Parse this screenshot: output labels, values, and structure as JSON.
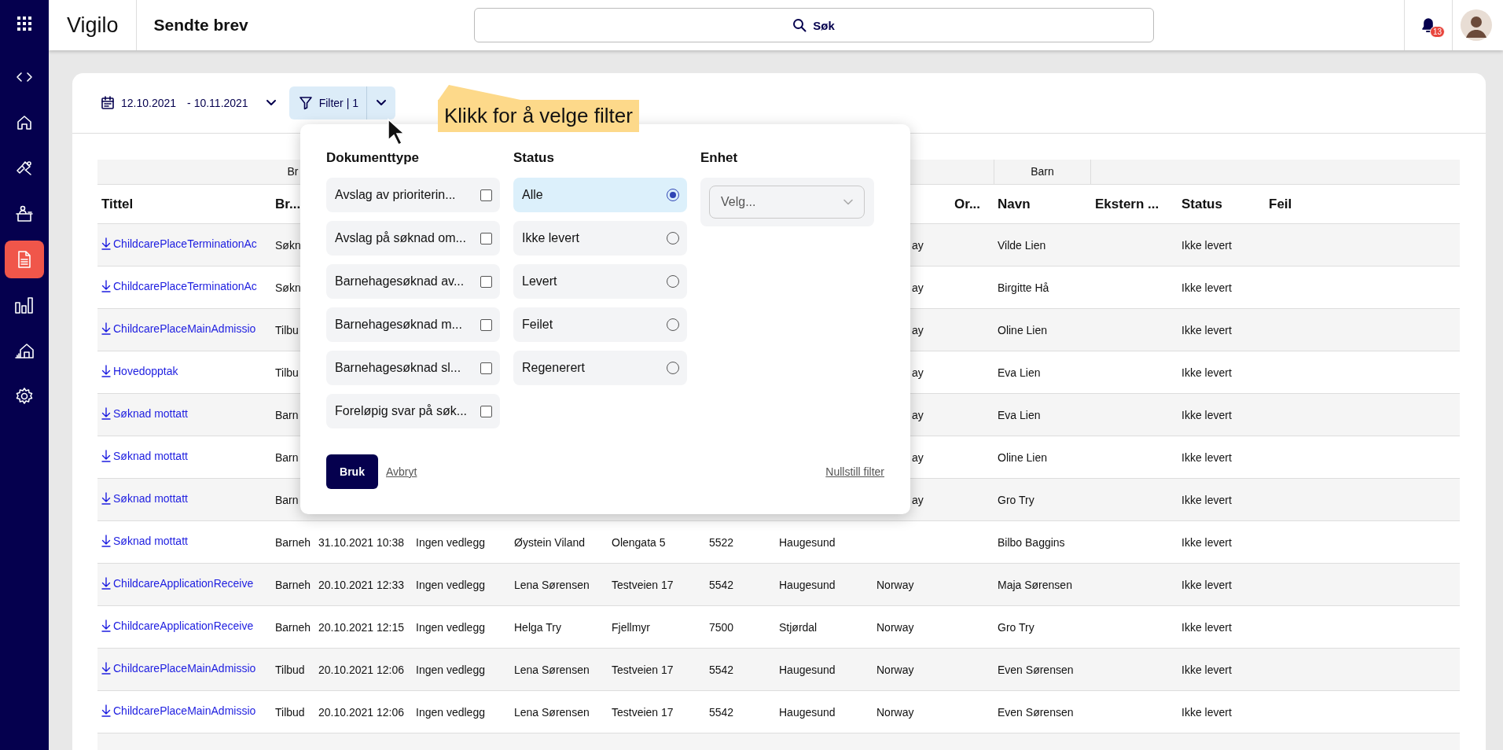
{
  "sidebar": {
    "items": [
      {
        "kind": "apps",
        "selected": false
      },
      {
        "kind": "code",
        "selected": false
      },
      {
        "kind": "home",
        "selected": false
      },
      {
        "kind": "tools",
        "selected": false
      },
      {
        "kind": "desk",
        "selected": false
      },
      {
        "kind": "document",
        "selected": true
      },
      {
        "kind": "chart",
        "selected": false
      },
      {
        "kind": "school",
        "selected": false
      },
      {
        "kind": "settings",
        "selected": false
      }
    ]
  },
  "header": {
    "logo": "Vigilo",
    "page_title": "Sendte brev",
    "search": {
      "label": "Søk"
    },
    "notifications": {
      "count": "13"
    }
  },
  "toolbar": {
    "date_from": "12.10.2021",
    "date_to": "- 10.11.2021",
    "filter_button": {
      "label": "Filter | 1"
    }
  },
  "tooltip": {
    "text": "Klikk for å velge filter"
  },
  "filter_panel": {
    "document_types": {
      "heading": "Dokumenttype",
      "options": [
        {
          "label": "Avslag av prioriterin...",
          "checked": false
        },
        {
          "label": "Avslag på søknad om...",
          "checked": false
        },
        {
          "label": "Barnehagesøknad av...",
          "checked": false
        },
        {
          "label": "Barnehagesøknad m...",
          "checked": false
        },
        {
          "label": "Barnehagesøknad sl...",
          "checked": false
        },
        {
          "label": "Foreløpig svar på søk...",
          "checked": false
        }
      ]
    },
    "status": {
      "heading": "Status",
      "options": [
        {
          "label": "Alle",
          "selected": true
        },
        {
          "label": "Ikke levert",
          "selected": false
        },
        {
          "label": "Levert",
          "selected": false
        },
        {
          "label": "Feilet",
          "selected": false
        },
        {
          "label": "Regenerert",
          "selected": false
        }
      ]
    },
    "unit": {
      "heading": "Enhet",
      "placeholder": "Velg..."
    },
    "apply": "Bruk",
    "cancel": "Avbryt",
    "reset": "Nullstill filter"
  },
  "table": {
    "group_headers": {
      "br": "Br",
      "navn": "Barn"
    },
    "headers": {
      "title": "Tittel",
      "br": "Br...",
      "or": "Or...",
      "navn": "Navn",
      "ekstern": "Ekstern ...",
      "status": "Status",
      "feil": "Feil"
    },
    "rows": [
      {
        "title": "ChildcarePlaceTerminationAc",
        "br": "Søkn",
        "column_9_tail": "ay",
        "navn": "Vilde Lien",
        "status": "Ikke levert"
      },
      {
        "title": "ChildcarePlaceTerminationAc",
        "br": "Søkn",
        "column_9_tail": "ay",
        "navn": "Birgitte Hå",
        "status": "Ikke levert"
      },
      {
        "title": "ChildcarePlaceMainAdmissio",
        "br": "Tilbu",
        "column_9_tail": "ay",
        "navn": "Oline Lien",
        "status": "Ikke levert"
      },
      {
        "title": "Hovedopptak",
        "br": "Tilbu",
        "column_9_tail": "ay",
        "navn": "Eva Lien",
        "status": "Ikke levert"
      },
      {
        "title": "Søknad mottatt",
        "br": "Barn",
        "column_9_tail": "ay",
        "navn": "Eva Lien",
        "status": "Ikke levert"
      },
      {
        "title": "Søknad mottatt",
        "br": "Barn",
        "column_9_tail": "ay",
        "navn": "Oline Lien",
        "status": "Ikke levert"
      },
      {
        "title": "Søknad mottatt",
        "br": "Barn",
        "column_9_tail": "ay",
        "navn": "Gro Try",
        "status": "Ikke levert"
      },
      {
        "title": "Søknad mottatt",
        "br": "Barneh",
        "column_3": "31.10.2021 10:38",
        "column_4": "Ingen vedlegg",
        "column_5": "Øystein Viland",
        "column_6": "Olengata 5",
        "column_7": "5522",
        "column_8": "Haugesund",
        "navn": "Bilbo Baggins",
        "status": "Ikke levert"
      },
      {
        "title": "ChildcareApplicationReceive",
        "br": "Barneh",
        "column_3": "20.10.2021 12:33",
        "column_4": "Ingen vedlegg",
        "column_5": "Lena Sørensen",
        "column_6": "Testveien 17",
        "column_7": "5542",
        "column_8": "Haugesund",
        "column_9": "Norway",
        "navn": "Maja Sørensen",
        "status": "Ikke levert"
      },
      {
        "title": "ChildcareApplicationReceive",
        "br": "Barneh",
        "column_3": "20.10.2021 12:15",
        "column_4": "Ingen vedlegg",
        "column_5": "Helga Try",
        "column_6": "Fjellmyr",
        "column_7": "7500",
        "column_8": "Stjørdal",
        "column_9": "Norway",
        "navn": "Gro Try",
        "status": "Ikke levert"
      },
      {
        "title": "ChildcarePlaceMainAdmissio",
        "br": "Tilbud",
        "column_3": "20.10.2021 12:06",
        "column_4": "Ingen vedlegg",
        "column_5": "Lena Sørensen",
        "column_6": "Testveien 17",
        "column_7": "5542",
        "column_8": "Haugesund",
        "column_9": "Norway",
        "navn": "Even Sørensen",
        "status": "Ikke levert"
      },
      {
        "title": "ChildcarePlaceMainAdmissio",
        "br": "Tilbud",
        "column_3": "20.10.2021 12:06",
        "column_4": "Ingen vedlegg",
        "column_5": "Lena Sørensen",
        "column_6": "Testveien 17",
        "column_7": "5542",
        "column_8": "Haugesund",
        "column_9": "Norway",
        "navn": "Even Sørensen",
        "status": "Ikke levert"
      }
    ]
  }
}
